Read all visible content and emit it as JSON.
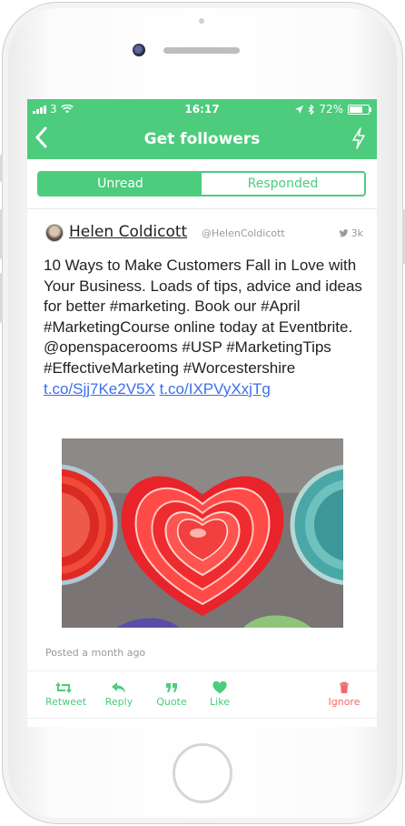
{
  "status": {
    "carrier": "3",
    "time": "16:17",
    "battery": "72%",
    "battery_level": 0.72
  },
  "navbar": {
    "title": "Get followers",
    "back_icon": "chevron-left-icon",
    "action_icon": "lightning-icon"
  },
  "tabs": [
    {
      "label": "Unread",
      "active": true
    },
    {
      "label": "Responded",
      "active": false
    }
  ],
  "tweet": {
    "user_name": "Helen Coldicott",
    "handle": "@HelenColdicott",
    "followers": "3k",
    "text": "10 Ways to Make Customers Fall in Love with Your Business. Loads of tips, advice and ideas for better #marketing. Book our #April #MarketingCourse online today at Eventbrite.  @openspacerooms #USP #MarketingTips #EffectiveMarketing #Worcestershire ",
    "links": [
      "t.co/Sjj7Ke2V5X",
      "t.co/IXPVyXxjTg"
    ],
    "posted": "Posted a month ago"
  },
  "actions": [
    {
      "label": "Retweet",
      "icon": "retweet-icon"
    },
    {
      "label": "Reply",
      "icon": "reply-icon"
    },
    {
      "label": "Quote",
      "icon": "quote-icon"
    },
    {
      "label": "Like",
      "icon": "heart-icon"
    },
    {
      "label": "Ignore",
      "icon": "trash-icon"
    }
  ],
  "colors": {
    "accent": "#4ccc7c",
    "link": "#3b6ef0",
    "danger": "#f06b6b"
  }
}
